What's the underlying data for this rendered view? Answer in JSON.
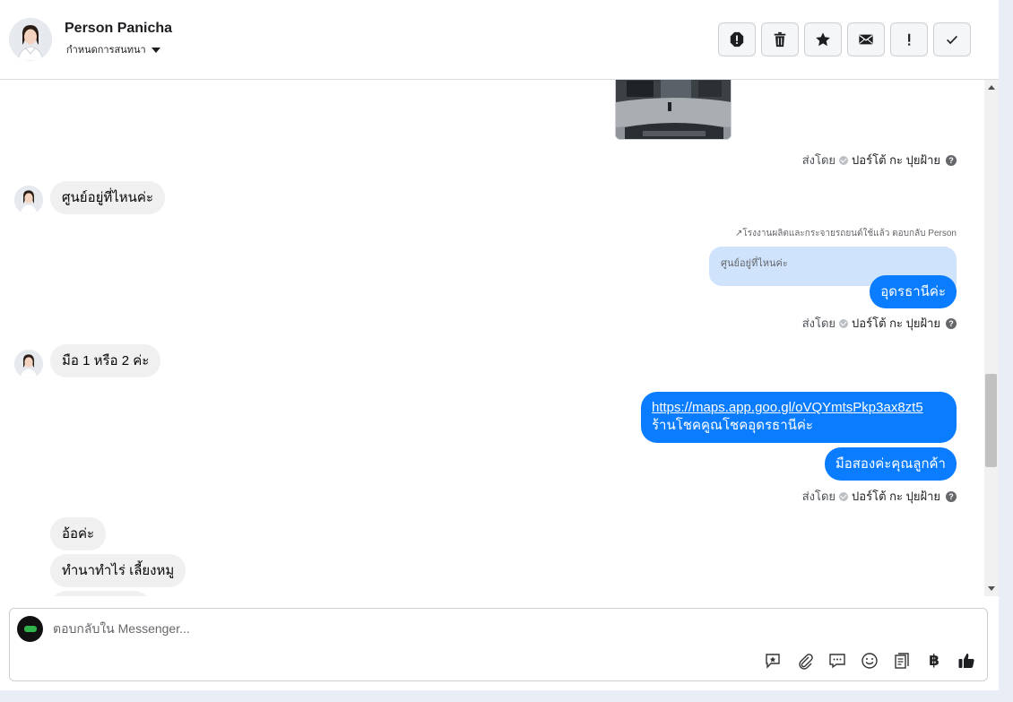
{
  "header": {
    "contact_name": "Person Panicha",
    "assign_label": "กำหนดการสนทนา",
    "actions": [
      "spam-icon",
      "trash-icon",
      "star-icon",
      "mail-icon",
      "exclamation-icon",
      "check-icon"
    ]
  },
  "messages": {
    "sent_by_prefix": "ส่งโดย",
    "agent_name": "ปอร์โต้ กะ ปุยฝ้าย",
    "m1_text": "ศูนย์อยู่ที่ไหนค่ะ",
    "reply_note": "↗โรงงานผลิตและกระจายรถยนต์ใช้แล้ว ตอบกลับ Person",
    "quoted_text": "ศูนย์อยู่ที่ไหนค่ะ",
    "m2_text": "อุดรธานีค่ะ",
    "m3_text": "มือ 1 หรือ 2 ค่ะ",
    "m4_link": "https://maps.app.goo.gl/oVQYmtsPkp3ax8zt5",
    "m4_text": "ร้านโชคคูณโชคอุดรธานีค่ะ",
    "m5_text": "มือสองค่ะคุณลูกค้า",
    "m6_text": "อ้อค่ะ",
    "m7_text": "ทำนาทำไร่ เลี้ยงหมู"
  },
  "composer": {
    "placeholder": "ตอบกลับใน Messenger...",
    "currency_symbol": "฿",
    "tools": [
      "saved-reply-icon",
      "attach-icon",
      "chat-icon",
      "emoji-icon",
      "notes-icon",
      "baht-icon",
      "like-icon"
    ]
  },
  "colors": {
    "outgoing_bubble": "#0a7cff",
    "incoming_bubble": "#f0f0f0",
    "quoted_bubble": "#cfe3fc"
  }
}
